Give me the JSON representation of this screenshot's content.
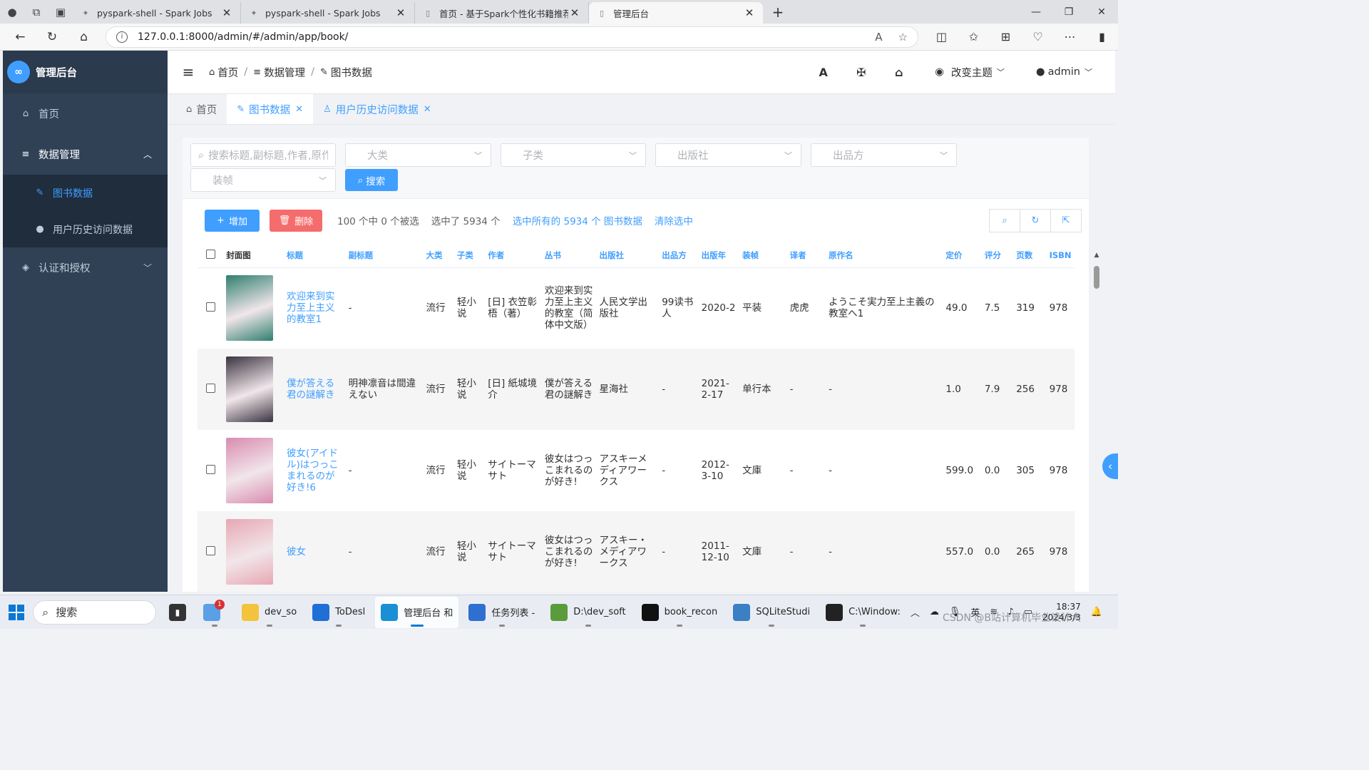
{
  "browser": {
    "tabs": [
      {
        "label": "pyspark-shell - Spark Jobs",
        "fav": "spark"
      },
      {
        "label": "pyspark-shell - Spark Jobs",
        "fav": "spark"
      },
      {
        "label": "首页 - 基于Spark个性化书籍推荐",
        "fav": "doc"
      },
      {
        "label": "管理后台",
        "fav": "doc"
      }
    ],
    "url": "127.0.0.1:8000/admin/#/admin/app/book/"
  },
  "sidebar": {
    "title": "管理后台",
    "items": [
      {
        "label": "首页"
      },
      {
        "label": "数据管理"
      },
      {
        "label": "图书数据"
      },
      {
        "label": "用户历史访问数据"
      },
      {
        "label": "认证和授权"
      }
    ]
  },
  "topbar": {
    "breadcrumb": [
      "首页",
      "数据管理",
      "图书数据"
    ],
    "theme": "改变主题",
    "user": "admin"
  },
  "tags": [
    {
      "label": "首页"
    },
    {
      "label": "图书数据"
    },
    {
      "label": "用户历史访问数据"
    }
  ],
  "filters": {
    "search_placeholder": "搜索标题,副标题,作者,原作",
    "category": "大类",
    "subcategory": "子类",
    "publisher": "出版社",
    "producer": "出品方",
    "binding": "装帧",
    "search_button": "搜索"
  },
  "actions": {
    "add": "增加",
    "delete": "删除",
    "selected_info": "100 个中 0 个被选",
    "selected_total": "选中了 5934 个",
    "select_all": "选中所有的 5934 个 图书数据",
    "clear": "清除选中"
  },
  "table": {
    "headers": [
      "封面图",
      "标题",
      "副标题",
      "大类",
      "子类",
      "作者",
      "丛书",
      "出版社",
      "出品方",
      "出版年",
      "装帧",
      "译者",
      "原作名",
      "定价",
      "评分",
      "页数",
      "ISBN"
    ],
    "rows": [
      {
        "cover_color": "#2f7f6e",
        "title": "欢迎来到实力至上主义的教室1",
        "subtitle": "-",
        "cat": "流行",
        "sub": "轻小说",
        "author": "[日] 衣笠彰梧（著）",
        "series": "欢迎来到实力至上主义的教室（简体中文版）",
        "publisher": "人民文学出版社",
        "producer": "99读书人",
        "year": "2020-2",
        "binding": "平装",
        "translator": "虎虎",
        "orig": "ようこそ実力至上主義の教室へ1",
        "price": "49.0",
        "rating": "7.5",
        "pages": "319",
        "isbn": "978"
      },
      {
        "cover_color": "#3a3340",
        "title": "僕が答える君の謎解き",
        "subtitle": "明神凛音は間違えない",
        "cat": "流行",
        "sub": "轻小说",
        "author": "[日] 紙城境介",
        "series": "僕が答える君の謎解き",
        "publisher": "星海社",
        "producer": "-",
        "year": "2021-2-17",
        "binding": "单行本",
        "translator": "-",
        "orig": "-",
        "price": "1.0",
        "rating": "7.9",
        "pages": "256",
        "isbn": "978"
      },
      {
        "cover_color": "#d98cb0",
        "title": "彼女(アイドル)はつっこまれるのが好き!6",
        "subtitle": "-",
        "cat": "流行",
        "sub": "轻小说",
        "author": "サイトーマサト",
        "series": "彼女はつっこまれるのが好き!",
        "publisher": "アスキーメディアワークス",
        "producer": "-",
        "year": "2012-3-10",
        "binding": "文庫",
        "translator": "-",
        "orig": "-",
        "price": "599.0",
        "rating": "0.0",
        "pages": "305",
        "isbn": "978"
      },
      {
        "cover_color": "#e8a7b3",
        "title": "彼女",
        "subtitle": "-",
        "cat": "流行",
        "sub": "轻小说",
        "author": "サイトーマサト",
        "series": "彼女はつっこまれるのが好き!",
        "publisher": "アスキー・メディアワークス",
        "producer": "-",
        "year": "2011-12-10",
        "binding": "文庫",
        "translator": "-",
        "orig": "-",
        "price": "557.0",
        "rating": "0.0",
        "pages": "265",
        "isbn": "978"
      }
    ]
  },
  "taskbar": {
    "search": "搜索",
    "apps": [
      {
        "label": "",
        "color": "#5aa0e6",
        "icon": "weather-icon",
        "badge": "1"
      },
      {
        "label": "dev_so",
        "color": "#f3c33c",
        "icon": "folder-icon"
      },
      {
        "label": "ToDesl",
        "color": "#1f6fd6",
        "icon": "todesk-icon"
      },
      {
        "label": "管理后台 和",
        "color": "#1a8fd6",
        "icon": "edge-icon"
      },
      {
        "label": "任务列表 -",
        "color": "#2e6fd0",
        "icon": "task-icon"
      },
      {
        "label": "D:\\dev_soft",
        "color": "#5a9b3c",
        "icon": "notepad-icon"
      },
      {
        "label": "book_recon",
        "color": "#111111",
        "icon": "pycharm-icon"
      },
      {
        "label": "SQLiteStudi",
        "color": "#3b7fc4",
        "icon": "sqlite-icon"
      },
      {
        "label": "C:\\Window:",
        "color": "#222222",
        "icon": "terminal-icon"
      }
    ],
    "ime": "英",
    "time": "18:37",
    "date": "2024/3/3"
  },
  "watermark": "CSDN @B站计算机毕业设计大"
}
